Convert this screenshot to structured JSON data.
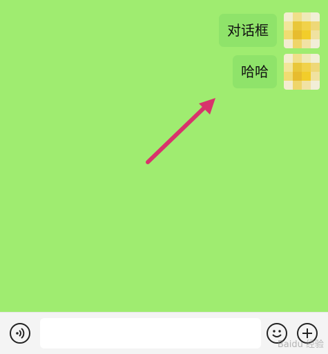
{
  "chat": {
    "messages": [
      {
        "text": "对话框",
        "sender": "self"
      },
      {
        "text": "哈哈",
        "sender": "self"
      }
    ]
  },
  "input_bar": {
    "text_value": "",
    "placeholder": ""
  },
  "icons": {
    "voice": "voice-icon",
    "emoji": "emoji-icon",
    "add": "plus-icon"
  },
  "colors": {
    "chat_background": "#9fec70",
    "bubble": "#8fe36a",
    "arrow": "#d8336c",
    "input_bar": "#f4f4f4"
  },
  "watermark": "Baidu 经验"
}
